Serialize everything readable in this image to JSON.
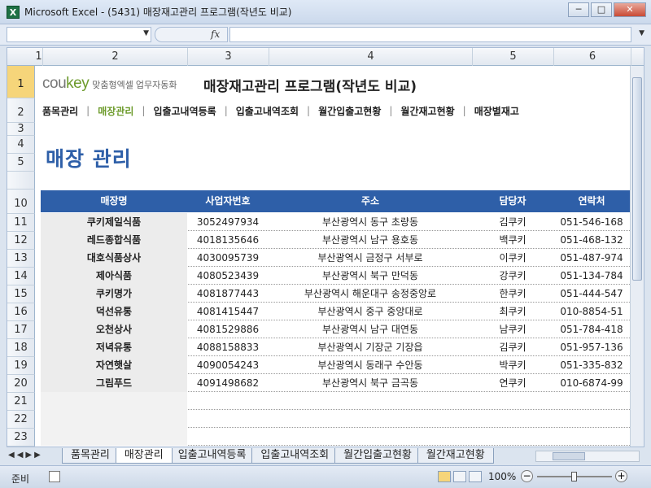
{
  "window": {
    "title": "Microsoft Excel - (5431) 매장재고관리 프로그램(작년도 비교)",
    "icon": "excel-icon",
    "min": "─",
    "max": "□",
    "close": "✕"
  },
  "formula": {
    "fx": "fx"
  },
  "columns": [
    "1",
    "2",
    "3",
    "4",
    "5",
    "6"
  ],
  "rows": [
    "1",
    "2",
    "3",
    "4",
    "5",
    "10",
    "11",
    "12",
    "13",
    "14",
    "15",
    "16",
    "17",
    "18",
    "19",
    "20",
    "21",
    "22",
    "23"
  ],
  "logo": {
    "brand1": "cou",
    "brand2": "key",
    "tagline": "맞춤형엑셀 업무자동화"
  },
  "app_title": "매장재고관리 프로그램(작년도 비교)",
  "nav": {
    "items": [
      "품목관리",
      "매장관리",
      "입출고내역등록",
      "입출고내역조회",
      "월간입출고현황",
      "월간재고현황",
      "매장별재고"
    ],
    "active": 1
  },
  "page_title": "매장 관리",
  "table": {
    "headers": [
      "매장명",
      "사업자번호",
      "주소",
      "담당자",
      "연락처"
    ],
    "rows": [
      [
        "쿠키제일식품",
        "3052497934",
        "부산광역시 동구 초량동",
        "김쿠키",
        "051-546-168"
      ],
      [
        "레드종합식품",
        "4018135646",
        "부산광역시 남구 용호동",
        "백쿠키",
        "051-468-132"
      ],
      [
        "대호식품상사",
        "4030095739",
        "부산광역시 금정구 서부로",
        "이쿠키",
        "051-487-974"
      ],
      [
        "제아식품",
        "4080523439",
        "부산광역시 북구 만덕동",
        "강쿠키",
        "051-134-784"
      ],
      [
        "쿠키명가",
        "4081877443",
        "부산광역시 해운대구 송정중앙로",
        "한쿠키",
        "051-444-547"
      ],
      [
        "덕선유통",
        "4081415447",
        "부산광역시 중구 중앙대로",
        "최쿠키",
        "010-8854-51"
      ],
      [
        "오천상사",
        "4081529886",
        "부산광역시 남구 대연동",
        "남쿠키",
        "051-784-418"
      ],
      [
        "저녁유통",
        "4088158833",
        "부산광역시 기장군 기장읍",
        "김쿠키",
        "051-957-136"
      ],
      [
        "자연햇살",
        "4090054243",
        "부산광역시 동래구 수안동",
        "박쿠키",
        "051-335-832"
      ],
      [
        "그림푸드",
        "4091498682",
        "부산광역시 북구 금곡동",
        "연쿠키",
        "010-6874-99"
      ]
    ]
  },
  "sheet_tabs": {
    "items": [
      "품목관리",
      "매장관리",
      "입출고내역등록",
      "입출고내역조회",
      "월간입출고현황",
      "월간재고현황"
    ],
    "active": 1
  },
  "status": {
    "ready": "준비",
    "zoom": "100%",
    "minus": "−",
    "plus": "+"
  }
}
